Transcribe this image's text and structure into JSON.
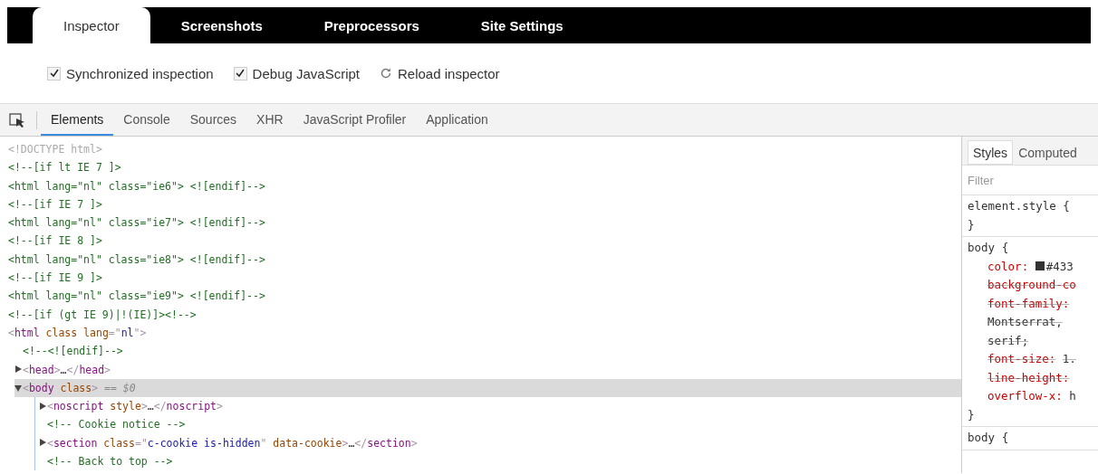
{
  "top_tabs": [
    {
      "label": "Inspector",
      "selected": true
    },
    {
      "label": "Screenshots",
      "selected": false
    },
    {
      "label": "Preprocessors",
      "selected": false
    },
    {
      "label": "Site Settings",
      "selected": false
    }
  ],
  "options": [
    {
      "kind": "checkbox",
      "label": "Synchronized inspection",
      "checked": true
    },
    {
      "kind": "checkbox",
      "label": "Debug JavaScript",
      "checked": true
    },
    {
      "kind": "action",
      "label": "Reload inspector"
    }
  ],
  "devtools_tabs": [
    {
      "label": "Elements",
      "selected": true
    },
    {
      "label": "Console",
      "selected": false
    },
    {
      "label": "Sources",
      "selected": false
    },
    {
      "label": "XHR",
      "selected": false
    },
    {
      "label": "JavaScript Profiler",
      "selected": false
    },
    {
      "label": "Application",
      "selected": false
    }
  ],
  "dom_tree": [
    {
      "parts": [
        {
          "kind": "doctype",
          "text": "<!DOCTYPE html>"
        }
      ],
      "selected": false
    },
    {
      "parts": [
        {
          "kind": "comment",
          "text": "<!--[if lt IE 7 ]>"
        }
      ],
      "selected": false
    },
    {
      "parts": [
        {
          "kind": "comment",
          "text": "<html lang=\"nl\" class=\"ie6\"> <![endif]-->"
        }
      ],
      "selected": false
    },
    {
      "parts": [
        {
          "kind": "comment",
          "text": "<!--[if IE 7 ]>"
        }
      ],
      "selected": false
    },
    {
      "parts": [
        {
          "kind": "comment",
          "text": "<html lang=\"nl\" class=\"ie7\"> <![endif]-->"
        }
      ],
      "selected": false
    },
    {
      "parts": [
        {
          "kind": "comment",
          "text": "<!--[if IE 8 ]>"
        }
      ],
      "selected": false
    },
    {
      "parts": [
        {
          "kind": "comment",
          "text": "<html lang=\"nl\" class=\"ie8\"> <![endif]-->"
        }
      ],
      "selected": false
    },
    {
      "parts": [
        {
          "kind": "comment",
          "text": "<!--[if IE 9 ]>"
        }
      ],
      "selected": false
    },
    {
      "parts": [
        {
          "kind": "comment",
          "text": "<html lang=\"nl\" class=\"ie9\"> <![endif]-->"
        }
      ],
      "selected": false
    },
    {
      "parts": [
        {
          "kind": "comment",
          "text": "<!--[if (gt IE 9)|!(IE)]><!-->"
        }
      ],
      "selected": false
    },
    {
      "parts": [
        {
          "kind": "bracket",
          "text": "<"
        },
        {
          "kind": "tag",
          "text": "html"
        },
        {
          "kind": "attr",
          "text": " class lang"
        },
        {
          "kind": "bracket",
          "text": "=\""
        },
        {
          "kind": "value",
          "text": "nl"
        },
        {
          "kind": "bracket",
          "text": "\">"
        }
      ],
      "selected": false,
      "children": [
        {
          "parts": [
            {
              "kind": "comment",
              "text": "<!--<![endif]-->"
            }
          ],
          "selected": false
        },
        {
          "parts": [
            {
              "kind": "bracket",
              "text": "<"
            },
            {
              "kind": "tag",
              "text": "head"
            },
            {
              "kind": "bracket",
              "text": ">"
            },
            {
              "kind": "text",
              "text": "…"
            },
            {
              "kind": "bracket",
              "text": "</"
            },
            {
              "kind": "tag",
              "text": "head"
            },
            {
              "kind": "bracket",
              "text": ">"
            }
          ],
          "expanded": false,
          "selected": false
        },
        {
          "parts": [
            {
              "kind": "bracket",
              "text": "<"
            },
            {
              "kind": "tag",
              "text": "body"
            },
            {
              "kind": "attr",
              "text": " class"
            },
            {
              "kind": "bracket",
              "text": ">"
            },
            {
              "kind": "marker",
              "text": " == $0"
            }
          ],
          "expanded": true,
          "selected": true,
          "children": [
            {
              "parts": [
                {
                  "kind": "bracket",
                  "text": "<"
                },
                {
                  "kind": "tag",
                  "text": "noscript"
                },
                {
                  "kind": "attr",
                  "text": " style"
                },
                {
                  "kind": "bracket",
                  "text": ">"
                },
                {
                  "kind": "text",
                  "text": "…"
                },
                {
                  "kind": "bracket",
                  "text": "</"
                },
                {
                  "kind": "tag",
                  "text": "noscript"
                },
                {
                  "kind": "bracket",
                  "text": ">"
                }
              ],
              "expanded": false,
              "selected": false
            },
            {
              "parts": [
                {
                  "kind": "comment",
                  "text": "<!-- Cookie notice -->"
                }
              ],
              "selected": false
            },
            {
              "parts": [
                {
                  "kind": "bracket",
                  "text": "<"
                },
                {
                  "kind": "tag",
                  "text": "section"
                },
                {
                  "kind": "attr",
                  "text": " class"
                },
                {
                  "kind": "bracket",
                  "text": "=\""
                },
                {
                  "kind": "value",
                  "text": "c-cookie is-hidden"
                },
                {
                  "kind": "bracket",
                  "text": "\""
                },
                {
                  "kind": "attr",
                  "text": " data-cookie"
                },
                {
                  "kind": "bracket",
                  "text": ">"
                },
                {
                  "kind": "text",
                  "text": "…"
                },
                {
                  "kind": "bracket",
                  "text": "</"
                },
                {
                  "kind": "tag",
                  "text": "section"
                },
                {
                  "kind": "bracket",
                  "text": ">"
                }
              ],
              "expanded": false,
              "selected": false
            },
            {
              "parts": [
                {
                  "kind": "comment",
                  "text": "<!-- Back to top -->"
                }
              ],
              "selected": false
            }
          ]
        }
      ]
    }
  ],
  "styles_pane": {
    "tabs": [
      {
        "label": "Styles",
        "selected": true
      },
      {
        "label": "Computed",
        "selected": false
      }
    ],
    "filter": {
      "placeholder": "Filter"
    },
    "rules": [
      {
        "selector": "element.style {",
        "close": "}"
      },
      {
        "selector": "body {",
        "close": "}",
        "declarations": [
          {
            "name": "color:",
            "value": [
              "#433"
            ],
            "swatch": true,
            "overridden": false
          },
          {
            "name": "background-co",
            "overridden": true
          },
          {
            "name": "font-family:",
            "value": [
              "Montserrat,",
              "serif;"
            ],
            "overridden": true
          },
          {
            "name": "font-size:",
            "value": [
              "1."
            ],
            "overridden": true
          },
          {
            "name": "line-height:",
            "overridden": true
          },
          {
            "name": "overflow-x:",
            "value": [
              "h"
            ],
            "overridden": false
          }
        ]
      },
      {
        "selector": "body {"
      }
    ]
  }
}
